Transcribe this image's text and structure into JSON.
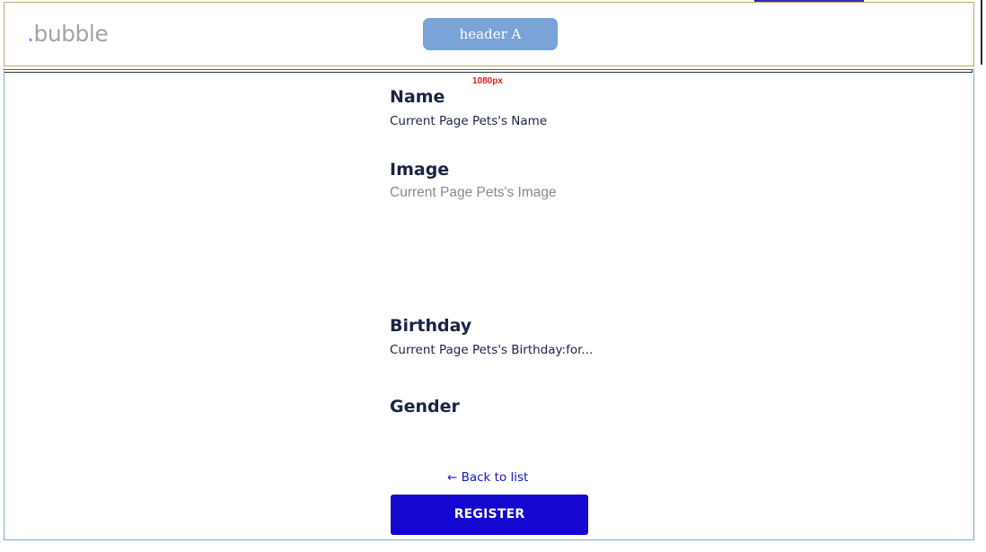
{
  "header": {
    "logo_dot": ".",
    "logo_text": "bubble",
    "button_label": "header A"
  },
  "ruler": {
    "label": "1080px"
  },
  "fields": {
    "name_label": "Name",
    "name_value": "Current Page Pets's Name",
    "image_label": "Image",
    "image_value": "Current Page Pets's Image",
    "birthday_label": "Birthday",
    "birthday_value": "Current Page Pets's Birthday:for...",
    "gender_label": "Gender"
  },
  "actions": {
    "back_link": "← Back to list",
    "register_label": "REGISTER"
  },
  "colors": {
    "header_button": "#7aa3d8",
    "register_button": "#1408d0",
    "link": "#1a16c8",
    "text_dark": "#1a2344",
    "ruler_label": "#e02020"
  }
}
